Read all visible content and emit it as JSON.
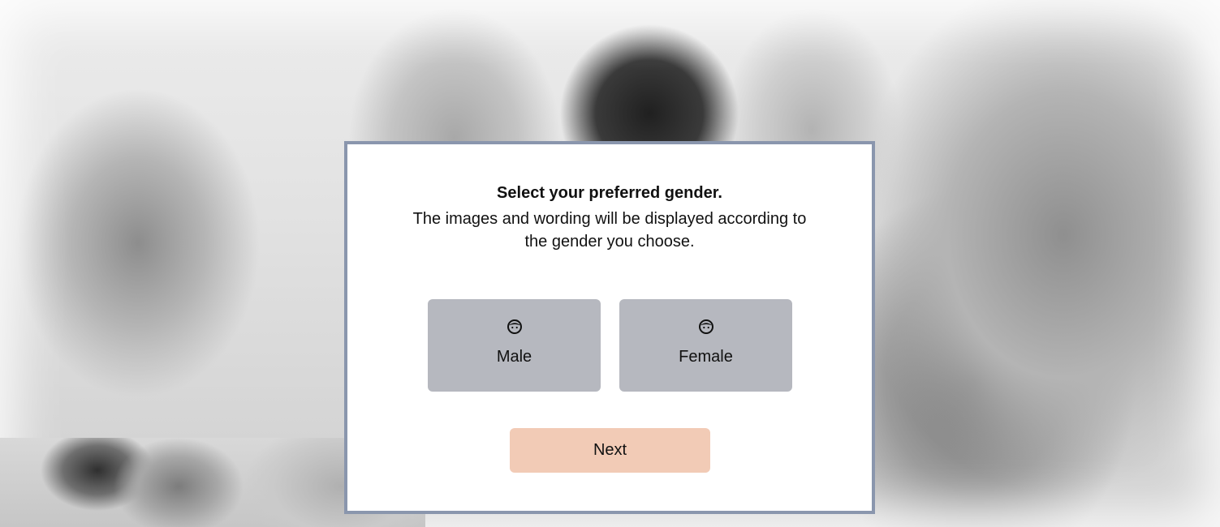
{
  "dialog": {
    "title": "Select your preferred gender.",
    "description": "The images and wording will be displayed according to the gender you choose."
  },
  "options": [
    {
      "label": "Male",
      "icon": "face-icon"
    },
    {
      "label": "Female",
      "icon": "face-icon"
    }
  ],
  "actions": {
    "next_label": "Next"
  },
  "colors": {
    "modal_border": "#8a96ad",
    "option_bg": "#b6b8bf",
    "next_bg": "#f2cbb6"
  }
}
